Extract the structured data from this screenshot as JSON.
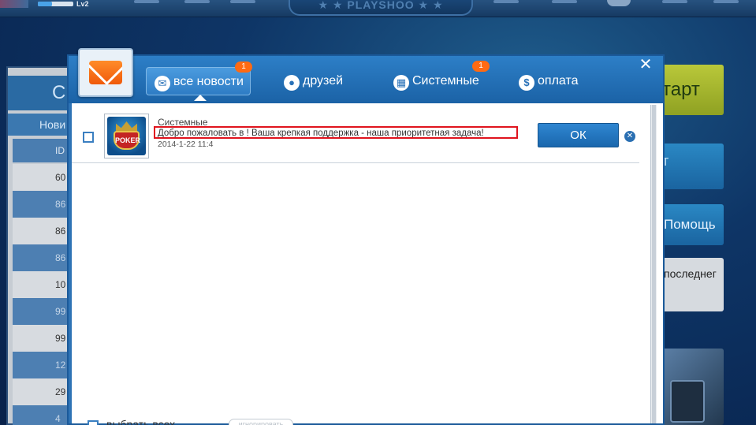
{
  "background": {
    "top_bar": {
      "level": "Lv2",
      "logo_text": "★ ★ PLAYSHOO ★ ★"
    },
    "left_panel": {
      "head": "С",
      "sub": "Нови",
      "id_col": "ID",
      "rows": [
        "60",
        "86",
        "86",
        "86",
        "10",
        "99",
        "99",
        "12",
        "29",
        "4"
      ]
    },
    "right_buttons": {
      "start": "тарт",
      "blue": "т",
      "help": "Помощь",
      "last": "последнег"
    }
  },
  "modal": {
    "tabs": [
      {
        "label": "все новости",
        "badge": "1",
        "icon": "mail-icon",
        "glyph": "✉"
      },
      {
        "label": "друзей",
        "badge": "",
        "icon": "person-icon",
        "glyph": "👤"
      },
      {
        "label": "Системные",
        "badge": "1",
        "icon": "grid-icon",
        "glyph": "▦"
      },
      {
        "label": "оплата",
        "badge": "",
        "icon": "dollar-icon",
        "glyph": "$"
      }
    ],
    "close_glyph": "✕",
    "message": {
      "category": "Системные",
      "text": "Добро пожаловать в ! Ваша крепкая поддержка - наша приоритетная задача!",
      "date": "2014-1-22 11:4",
      "icon_text": "POKER",
      "ok_label": "ОК",
      "delete_glyph": "✕"
    },
    "footer": {
      "select_all_label": "выбрать всех",
      "ignore_label": "игнорировать"
    }
  },
  "colors": {
    "header_blue": "#1b62a6",
    "badge_orange": "#ff6a13",
    "highlight_red": "#e0141e",
    "ok_blue": "#2f86d1"
  }
}
